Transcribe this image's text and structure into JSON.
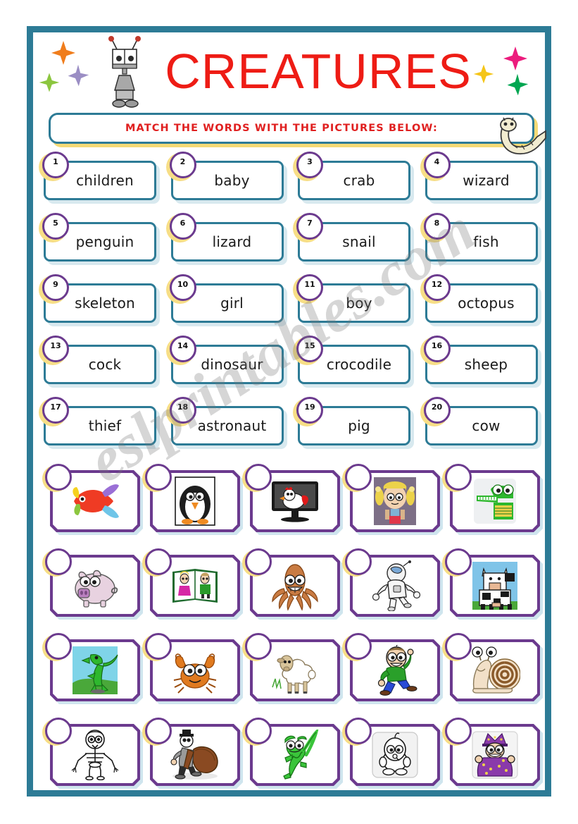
{
  "page": {
    "title": "CREATURES",
    "instruction": "MATCH THE WORDS WITH THE PICTURES BELOW:",
    "watermark": "eslprintables.com"
  },
  "colors": {
    "frame_teal": "#2d7b96",
    "title_red": "#ee1c15",
    "instruction_red": "#e02020",
    "circle_purple": "#6b3a8e",
    "glow_yellow": "#f7de86",
    "picture_border_purple": "#6b3a8e"
  },
  "decorations": {
    "robot": "robot-icon",
    "worm": "worm-icon",
    "stars": [
      {
        "name": "star-orange",
        "color": "#f07d1c"
      },
      {
        "name": "star-green",
        "color": "#8cc63f"
      },
      {
        "name": "star-purple",
        "color": "#9b8ec4"
      },
      {
        "name": "star-yellow",
        "color": "#f5c518"
      },
      {
        "name": "star-pink",
        "color": "#ec1c7d"
      },
      {
        "name": "star-green-dark",
        "color": "#00a651"
      }
    ]
  },
  "words": [
    {
      "number": "1",
      "label": "children"
    },
    {
      "number": "2",
      "label": "baby"
    },
    {
      "number": "3",
      "label": "crab"
    },
    {
      "number": "4",
      "label": "wizard"
    },
    {
      "number": "5",
      "label": "penguin"
    },
    {
      "number": "6",
      "label": "lizard"
    },
    {
      "number": "7",
      "label": "snail"
    },
    {
      "number": "8",
      "label": "fish"
    },
    {
      "number": "9",
      "label": "skeleton"
    },
    {
      "number": "10",
      "label": "girl"
    },
    {
      "number": "11",
      "label": "boy"
    },
    {
      "number": "12",
      "label": "octopus"
    },
    {
      "number": "13",
      "label": "cock"
    },
    {
      "number": "14",
      "label": "dinosaur"
    },
    {
      "number": "15",
      "label": "crocodile"
    },
    {
      "number": "16",
      "label": "sheep"
    },
    {
      "number": "17",
      "label": "thief"
    },
    {
      "number": "18",
      "label": "astronaut"
    },
    {
      "number": "19",
      "label": "pig"
    },
    {
      "number": "20",
      "label": "cow"
    }
  ],
  "pictures": [
    {
      "id": "fish-picture",
      "alt": "fish"
    },
    {
      "id": "penguin-picture",
      "alt": "penguin"
    },
    {
      "id": "cock-picture",
      "alt": "cock"
    },
    {
      "id": "girl-picture",
      "alt": "girl"
    },
    {
      "id": "crocodile-picture",
      "alt": "crocodile"
    },
    {
      "id": "pig-picture",
      "alt": "pig"
    },
    {
      "id": "children-picture",
      "alt": "children"
    },
    {
      "id": "octopus-picture",
      "alt": "octopus"
    },
    {
      "id": "astronaut-picture",
      "alt": "astronaut"
    },
    {
      "id": "cow-picture",
      "alt": "cow"
    },
    {
      "id": "dinosaur-picture",
      "alt": "dinosaur"
    },
    {
      "id": "crab-picture",
      "alt": "crab"
    },
    {
      "id": "sheep-picture",
      "alt": "sheep"
    },
    {
      "id": "boy-picture",
      "alt": "boy"
    },
    {
      "id": "snail-picture",
      "alt": "snail"
    },
    {
      "id": "skeleton-picture",
      "alt": "skeleton"
    },
    {
      "id": "thief-picture",
      "alt": "thief"
    },
    {
      "id": "lizard-picture",
      "alt": "lizard"
    },
    {
      "id": "baby-picture",
      "alt": "baby"
    },
    {
      "id": "wizard-picture",
      "alt": "wizard"
    }
  ]
}
